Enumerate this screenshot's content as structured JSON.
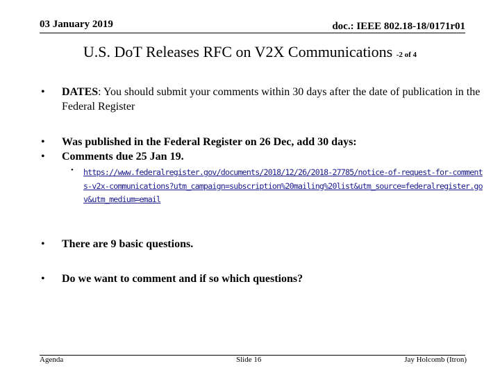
{
  "header": {
    "date": "03 January 2019",
    "doc_id": "doc.: IEEE 802.18-18/0171r01"
  },
  "title": {
    "main": "U.S. DoT Releases RFC on V2X Communications",
    "sub": "-2 of 4"
  },
  "bullets": {
    "dates_label": "DATES",
    "dates_text": ": You should submit your comments within 30 days after the date of publication in the Federal Register",
    "published": "Was published in the Federal Register on 26 Dec, add 30 days:",
    "due": "Comments due 25 Jan 19.",
    "link": "https://www.federalregister.gov/documents/2018/12/26/2018-27785/notice-of-request-for-comments-v2x-communications?utm_campaign=subscription%20mailing%20list&utm_source=federalregister.gov&utm_medium=email",
    "questions": "There are 9 basic questions.",
    "comment": "Do we want to comment and if so which questions?",
    "bullet_glyph": "•"
  },
  "footer": {
    "left": "Agenda",
    "center": "Slide 16",
    "right": "Jay Holcomb (Itron)"
  }
}
